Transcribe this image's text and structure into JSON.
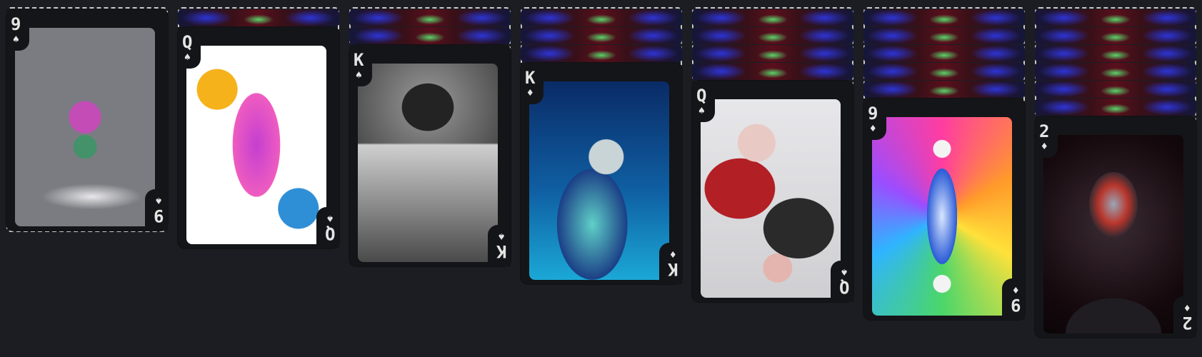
{
  "columns": [
    {
      "rank": "9",
      "suit": "♠",
      "suit_name": "spade",
      "hidden": 0,
      "art_bg": "linear-gradient(160deg,#dadbe0 0%,#a9abb3 55%,#6c6e76 100%)",
      "art_fg": "radial-gradient(circle at 50% 45%, rgba(220,60,200,0.75) 0 22px, transparent 23px), radial-gradient(circle at 50% 60%, rgba(30,160,90,0.6) 0 16px, transparent 17px), radial-gradient(ellipse 70px 18px at 55% 85%, #e8e8ea 0%, #7b7c82 100%)"
    },
    {
      "rank": "Q",
      "suit": "♠",
      "suit_name": "spade",
      "hidden": 1,
      "art_bg": "linear-gradient(180deg,#ffffff 0%,#ffffff 100%)",
      "art_fg": "radial-gradient(circle at 22% 22%, #f5b21b 0 28px, transparent 29px), radial-gradient(circle at 80% 82%, #2e8ed6 0 28px, transparent 29px), radial-gradient(ellipse 55px 120px at 50% 50%, #c43fd0 0%, #ef5cc0 60%, transparent 61%)"
    },
    {
      "rank": "K",
      "suit": "♠",
      "suit_name": "spade",
      "hidden": 2,
      "art_bg": "radial-gradient(circle at 50% 20%, #9a9a9a 0%, #3e3e3e 55%, #1e1e1e 100%)",
      "art_fg": "radial-gradient(ellipse 60px 55px at 50% 22%, #232323 0 60%, transparent 61%), linear-gradient(180deg, transparent 40%, #cfcfcf 41%, #4a4a4a 100%)"
    },
    {
      "rank": "K",
      "suit": "♦",
      "suit_name": "diamond",
      "hidden": 3,
      "art_bg": "linear-gradient(180deg,#0a2b66 0%,#0f5fa3 55%,#1ba8d6 100%)",
      "art_fg": "radial-gradient(circle at 55% 38%, #c9d4d6 0 24px, transparent 25px), radial-gradient(ellipse 70px 110px at 45% 72%, #5fd0c8 0%, #1b3f86 70%, transparent 71%)"
    },
    {
      "rank": "Q",
      "suit": "♠",
      "suit_name": "spade",
      "hidden": 4,
      "art_bg": "linear-gradient(180deg,#e7e7ea 0%,#cfcfd2 100%)",
      "art_fg": "radial-gradient(circle at 40% 22%, #e9c9c4 0 26px, transparent 27px), radial-gradient(ellipse 70px 60px at 28% 45%, #b21f24 0 70%, transparent 71%), radial-gradient(ellipse 70px 60px at 70% 65%, #2a2a2a 0 70%, transparent 71%), radial-gradient(circle at 55% 85%, #e4b5ae 0 20px, transparent 21px)"
    },
    {
      "rank": "9",
      "suit": "♦",
      "suit_name": "diamond",
      "hidden": 5,
      "art_bg": "conic-gradient(from 0deg at 50% 50%, #ff3da0, #ff9a2a, #ffe13a, #4bd66a, #2fb4ff, #9b4dff, #ff3da0)",
      "art_fg": "radial-gradient(ellipse 30px 95px at 50% 50%, #d8e6ff 0%, #2b5bd6 70%, transparent 71%), radial-gradient(circle at 50% 16%, #f3f3f3 0 12px, transparent 13px), radial-gradient(circle at 50% 84%, #f3f3f3 0 12px, transparent 13px)"
    },
    {
      "rank": "2",
      "suit": "♦",
      "suit_name": "diamond",
      "hidden": 6,
      "art_bg": "radial-gradient(circle at 50% 45%, #3a2b33 0%, #15090d 70%, #0b0507 100%)",
      "art_fg": "radial-gradient(ellipse 45px 60px at 50% 35%, #9aa6b6 0%, #b8362c 45%, #3b2a30 75%, transparent 76%), radial-gradient(ellipse 95px 70px at 50% 100%, #1f1c22 0 70%, transparent 71%)"
    }
  ]
}
